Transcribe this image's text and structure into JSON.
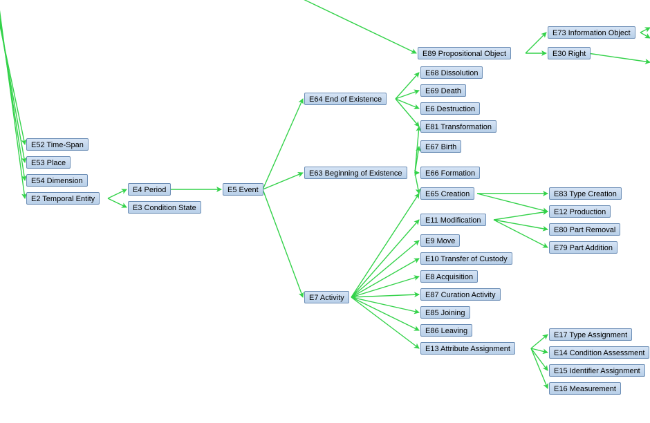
{
  "diagram": {
    "nodes": {
      "e52": "E52 Time-Span",
      "e53": "E53 Place",
      "e54": "E54 Dimension",
      "e2": "E2 Temporal Entity",
      "e4": "E4 Period",
      "e3": "E3 Condition State",
      "e5": "E5 Event",
      "e64": "E64 End of Existence",
      "e63": "E63 Beginning of Existence",
      "e7": "E7 Activity",
      "e68": "E68 Dissolution",
      "e69": "E69 Death",
      "e6": "E6 Destruction",
      "e81": "E81 Transformation",
      "e67": "E67 Birth",
      "e66": "E66 Formation",
      "e65": "E65 Creation",
      "e11": "E11 Modification",
      "e9": "E9 Move",
      "e10": "E10 Transfer of Custody",
      "e8": "E8 Acquisition",
      "e87": "E87 Curation Activity",
      "e85": "E85 Joining",
      "e86": "E86 Leaving",
      "e13": "E13 Attribute Assignment",
      "e89": "E89 Propositional Object",
      "e73": "E73 Information Object",
      "e30": "E30 Right",
      "e83": "E83 Type Creation",
      "e12": "E12 Production",
      "e80": "E80 Part Removal",
      "e79": "E79 Part Addition",
      "e17": "E17 Type Assignment",
      "e14": "E14 Condition Assessment",
      "e15": "E15 Identifier Assignment",
      "e16": "E16 Measurement"
    }
  }
}
